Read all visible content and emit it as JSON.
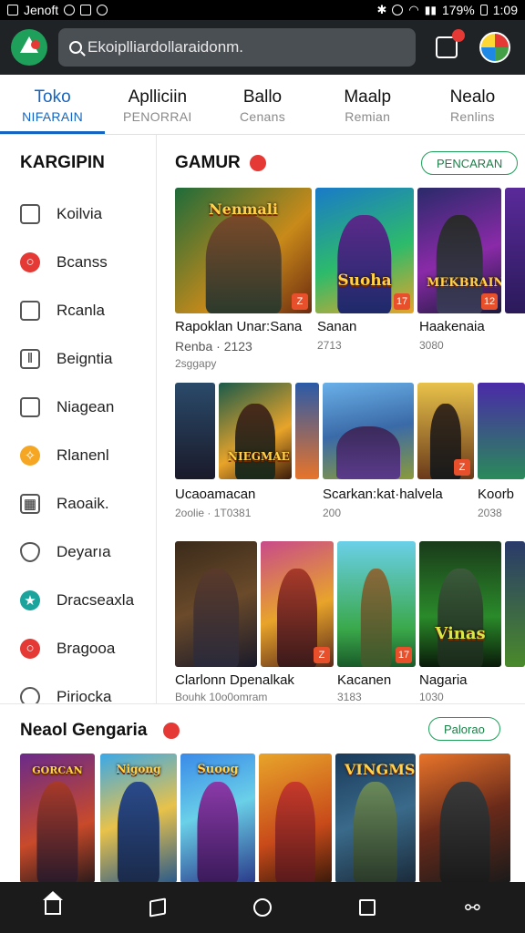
{
  "status_bar": {
    "carrier": "Jenoft",
    "battery": "179%",
    "time": "1:09"
  },
  "header": {
    "search_placeholder": "Ekoiplliardollaraidonm."
  },
  "tabs": [
    {
      "label": "Toko",
      "sub": "NIFARAIN"
    },
    {
      "label": "Aplliciin",
      "sub": "PENORRAI"
    },
    {
      "label": "Ballo",
      "sub": "Cenans"
    },
    {
      "label": "Maalp",
      "sub": "Remian"
    },
    {
      "label": "Nealo",
      "sub": "Renlins"
    }
  ],
  "sidebar": {
    "title": "KARGIPIN",
    "items": [
      {
        "label": "Koilvia",
        "icon": "ticket-icon"
      },
      {
        "label": "Bcanss",
        "icon": "red-search-icon"
      },
      {
        "label": "Rcanla",
        "icon": "box-icon"
      },
      {
        "label": "Beigntia",
        "icon": "columns-icon"
      },
      {
        "label": "Niagean",
        "icon": "frame-icon"
      },
      {
        "label": "Rlanenl",
        "icon": "orange-badge-icon"
      },
      {
        "label": "Raoaik.",
        "icon": "grid-icon"
      },
      {
        "label": "Deyarıa",
        "icon": "shield-icon"
      },
      {
        "label": "Dracseaxla",
        "icon": "teal-star-icon"
      },
      {
        "label": "Bragooa",
        "icon": "red-circle-icon"
      },
      {
        "label": "Piriocka",
        "icon": "ring-icon"
      }
    ]
  },
  "main": {
    "section_title": "GAMUR",
    "section_button": "PENCARAN",
    "row1": [
      {
        "art": "Nenmali",
        "title": "Rapoklan  Unar:Sana",
        "meta": "Renba  ·  2123",
        "extra": "2sggapy"
      },
      {
        "art": "Suoha",
        "title": "Sanan",
        "meta": "2713"
      },
      {
        "art": "MEKBRAIN",
        "title": "Haakenaia",
        "meta": "3080"
      }
    ],
    "row2": [
      {
        "art": "NIEGMAE",
        "title": "Ucaoamacan",
        "meta": "2oolie  ·  1T0381"
      },
      {
        "art": "",
        "title": "Scarkan:kat·halvela",
        "meta": "200"
      },
      {
        "art": "",
        "title": "Koorb",
        "meta": "2038"
      }
    ],
    "row3": [
      {
        "art": "",
        "title": "Clarlonn Dpenalkak",
        "meta": "Bouhk  10o0omram"
      },
      {
        "art": "",
        "title": "Kacanen",
        "meta": "3183"
      },
      {
        "art": "Vinas",
        "title": "Nagaria",
        "meta": "1030"
      }
    ]
  },
  "bottom": {
    "title": "Neaol Gengaria",
    "button": "Palorao",
    "cards": [
      "GORCAN",
      "Nigong",
      "Suoog",
      "",
      "VINGMS",
      ""
    ]
  }
}
